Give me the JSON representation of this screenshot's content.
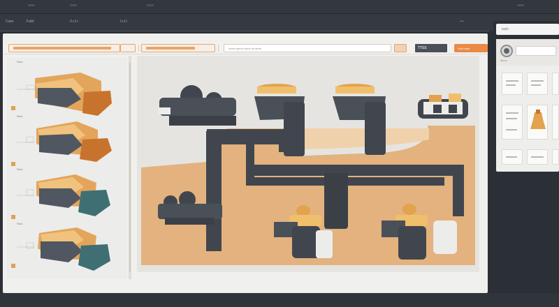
{
  "menubar": {
    "items": [
      "Cam",
      "Fabl",
      "Bulls",
      "bulk"
    ]
  },
  "toolbar": {
    "search_text": "lorem ipsum dolor sit amet",
    "action_label": "Sare sate",
    "dark_label": "TTEE"
  },
  "left_panel": {
    "thumbnails": [
      {
        "label": "Roto",
        "accent": "#e08a3a"
      },
      {
        "label": "Roto",
        "accent": "#e08a3a"
      },
      {
        "label": "Roto",
        "accent": "#3f6f72"
      },
      {
        "label": "Roto",
        "accent": "#3f6f72"
      }
    ]
  },
  "sidebar": {
    "top_label": "auto",
    "sub_label": "items",
    "tiles": [
      "Cerrd",
      "Ladd",
      "Nemd",
      "Scsd",
      "Bot",
      "Carl"
    ]
  },
  "colors": {
    "accent": "#e8873f",
    "sand": "#e3b27e",
    "dark": "#454a52",
    "teal": "#3f6f72"
  },
  "icons": [
    "avatar-icon",
    "search-icon",
    "pipe-diagram"
  ]
}
